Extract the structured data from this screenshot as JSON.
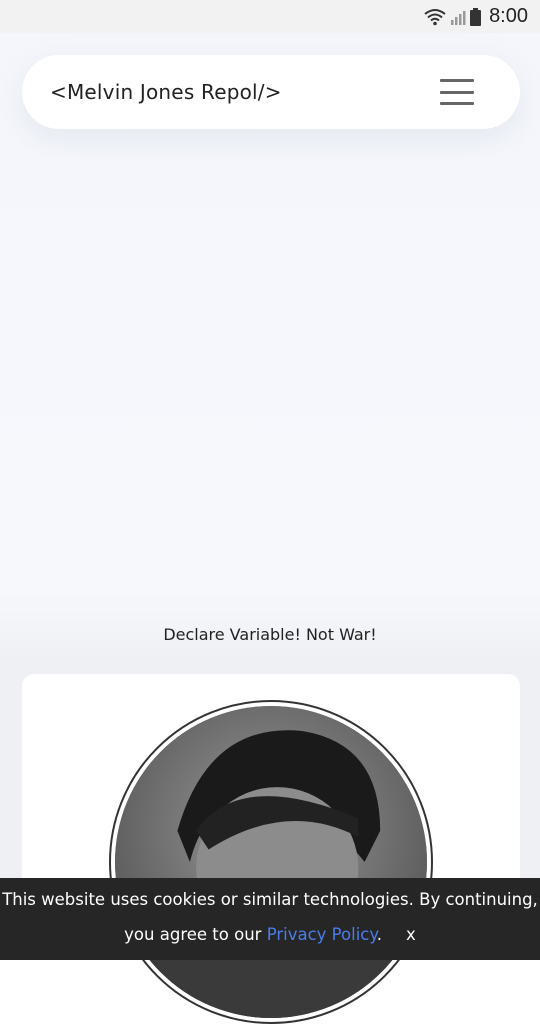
{
  "status_bar": {
    "time": "8:00"
  },
  "navbar": {
    "brand": "<Melvin Jones Repol/>"
  },
  "hero": {
    "tagline": "Declare Variable! Not War!"
  },
  "cookie_banner": {
    "text_before": "This website uses cookies or similar technologies. By continuing, you agree to our ",
    "link_text": "Privacy Policy",
    "text_after": ".",
    "close_label": "x"
  }
}
